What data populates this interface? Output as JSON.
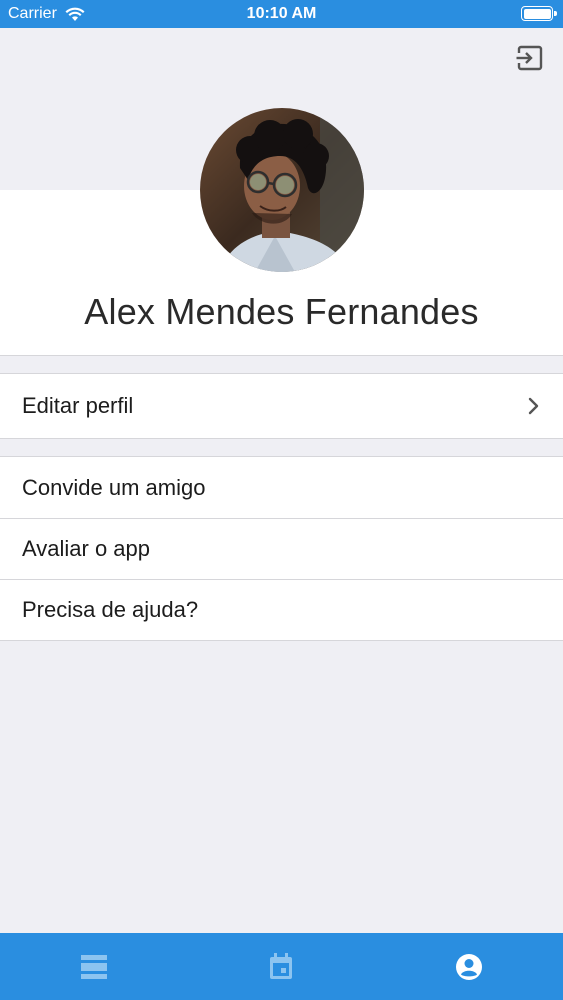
{
  "status_bar": {
    "carrier": "Carrier",
    "time": "10:10 AM",
    "battery_level": 1.0,
    "wifi_icon": "wifi-icon"
  },
  "header": {
    "logout_icon": "logout-icon"
  },
  "profile": {
    "name": "Alex Mendes Fernandes",
    "avatar": "avatar"
  },
  "menu": {
    "edit_profile": {
      "label": "Editar perfil",
      "icon": "chevron-right-icon"
    },
    "items": [
      {
        "label": "Convide um amigo"
      },
      {
        "label": "Avaliar o app"
      },
      {
        "label": "Precisa de ajuda?"
      }
    ]
  },
  "tab_bar": {
    "tabs": [
      {
        "icon": "list-icon",
        "active": false
      },
      {
        "icon": "calendar-icon",
        "active": false
      },
      {
        "icon": "profile-icon",
        "active": true
      }
    ]
  },
  "colors": {
    "accent": "#2a8ee0",
    "background": "#efeff4",
    "tab_inactive": "#8cc4f0",
    "tab_active": "#ffffff"
  }
}
